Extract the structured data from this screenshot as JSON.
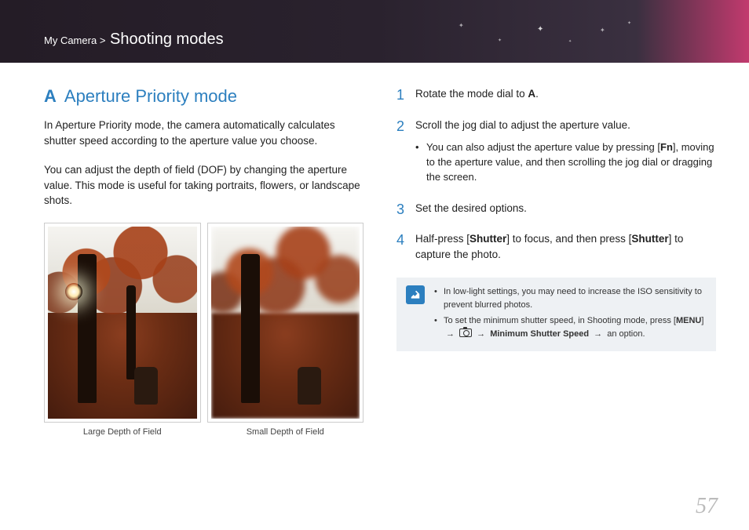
{
  "header": {
    "breadcrumb_root": "My Camera",
    "breadcrumb_sep": ">",
    "breadcrumb_section": "Shooting modes"
  },
  "left": {
    "title_icon": "A",
    "title": "Aperture Priority mode",
    "para1": "In Aperture Priority mode, the camera automatically calculates shutter speed according to the aperture value you choose.",
    "para2": "You can adjust the depth of field (DOF) by changing the aperture value. This mode is useful for taking portraits, flowers, or landscape shots.",
    "caption1": "Large Depth of Field",
    "caption2": "Small Depth of Field"
  },
  "steps": {
    "s1_pre": "Rotate the mode dial to ",
    "s1_icon": "A",
    "s1_post": ".",
    "s2": "Scroll the jog dial to adjust the aperture value.",
    "s2_sub_pre": "You can also adjust the aperture value by pressing [",
    "s2_sub_icon": "Fn",
    "s2_sub_post": "], moving to the aperture value, and then scrolling the jog dial or dragging the screen.",
    "s3": "Set the desired options.",
    "s4_pre": "Half-press [",
    "s4_b1": "Shutter",
    "s4_mid": "] to focus, and then press [",
    "s4_b2": "Shutter",
    "s4_post": "] to capture the photo."
  },
  "note": {
    "n1": "In low-light settings, you may need to increase the ISO sensitivity to prevent blurred photos.",
    "n2_pre": "To set the minimum shutter speed, in Shooting mode, press [",
    "n2_menu": "MENU",
    "n2_mid1": "] ",
    "n2_arrow": "→",
    "n2_mid2": " ",
    "n2_bold": "Minimum Shutter Speed",
    "n2_post": " an option."
  },
  "page_number": "57"
}
